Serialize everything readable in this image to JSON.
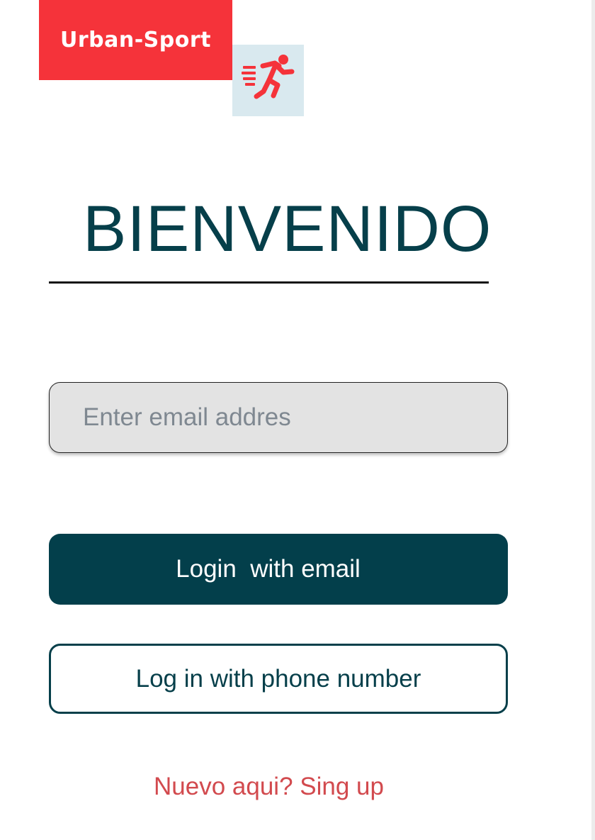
{
  "brand": {
    "name": "Urban-Sport",
    "logo_icon": "running-person-icon",
    "brand_color": "#f5333a",
    "logo_background": "#d9e9ef"
  },
  "welcome": {
    "title": "BIENVENIDO"
  },
  "email_field": {
    "value": "",
    "placeholder": "Enter email addres"
  },
  "buttons": {
    "login_email_label": "Login  with email",
    "login_phone_label": "Log in with phone number"
  },
  "signup": {
    "text": "Nuevo aqui? Sing up"
  },
  "colors": {
    "primary": "#033f4b",
    "accent": "#f5333a",
    "link": "#d24a4e"
  }
}
